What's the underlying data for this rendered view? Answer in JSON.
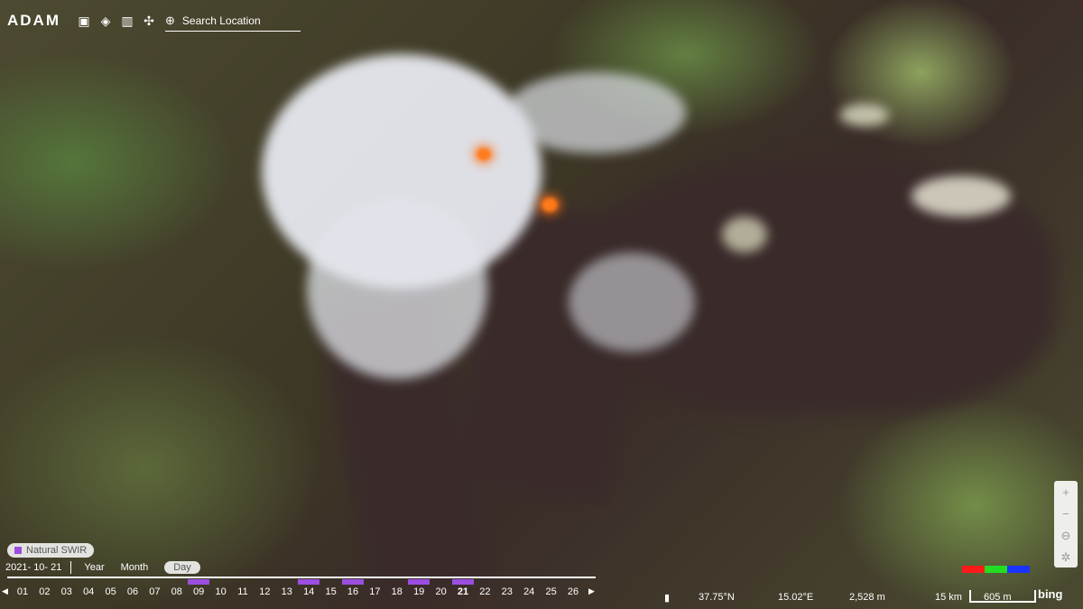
{
  "app": {
    "logo_text": "ADAM"
  },
  "toolbar": {
    "icons": [
      "buildings-icon",
      "layers-icon",
      "chart-icon",
      "share-icon"
    ],
    "search_placeholder": "Search Location"
  },
  "layer": {
    "label": "Natural SWIR",
    "color": "#9b4ee0"
  },
  "timeline": {
    "date": "2021- 10- 21",
    "scales": [
      "Year",
      "Month",
      "Day"
    ],
    "active_scale": "Day",
    "days": [
      "01",
      "02",
      "03",
      "04",
      "05",
      "06",
      "07",
      "08",
      "09",
      "10",
      "11",
      "12",
      "13",
      "14",
      "15",
      "16",
      "17",
      "18",
      "19",
      "20",
      "21",
      "22",
      "23",
      "24",
      "25",
      "26"
    ],
    "current_day": "21",
    "marked_days": [
      "09",
      "14",
      "16",
      "19",
      "21"
    ]
  },
  "status": {
    "latitude": "37.75°N",
    "longitude": "15.02°E",
    "elevation": "2,528 m",
    "distance": "15 km",
    "scale_label": "605 m",
    "attribution": "bing"
  },
  "rgb_colors": [
    "#ff1a1a",
    "#22dd22",
    "#1a33ff"
  ]
}
